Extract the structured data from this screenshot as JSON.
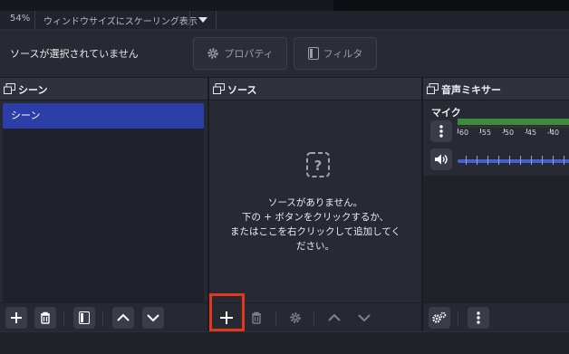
{
  "status": {
    "zoom": "54%",
    "scale_mode": "ウィンドウサイズにスケーリング表示"
  },
  "context": {
    "no_source": "ソースが選択されていません",
    "properties_label": "プロパティ",
    "filters_label": "フィルタ"
  },
  "scenes": {
    "title": "シーン",
    "items": [
      "シーン"
    ]
  },
  "sources": {
    "title": "ソース",
    "empty_lines": [
      "ソースがありません。",
      "下の + ボタンをクリックするか、",
      "またはここを右クリックして追加してく",
      "ださい。"
    ]
  },
  "mixer": {
    "title": "音声ミキサー",
    "channel": "マイク",
    "scale": [
      "-60",
      "-55",
      "-50",
      "-45",
      "-40"
    ]
  },
  "icons": [
    "dock-icon",
    "gear-icon",
    "filter-icon",
    "help-icon",
    "plus-icon",
    "trash-icon",
    "filter-icon",
    "chevron-up-icon",
    "chevron-down-icon",
    "kebab-icon",
    "speaker-icon"
  ],
  "colors": {
    "accent": "#2c3fa8",
    "meter": "#3f8a3b",
    "slider": "#4460d0",
    "highlight": "#e3381f"
  }
}
